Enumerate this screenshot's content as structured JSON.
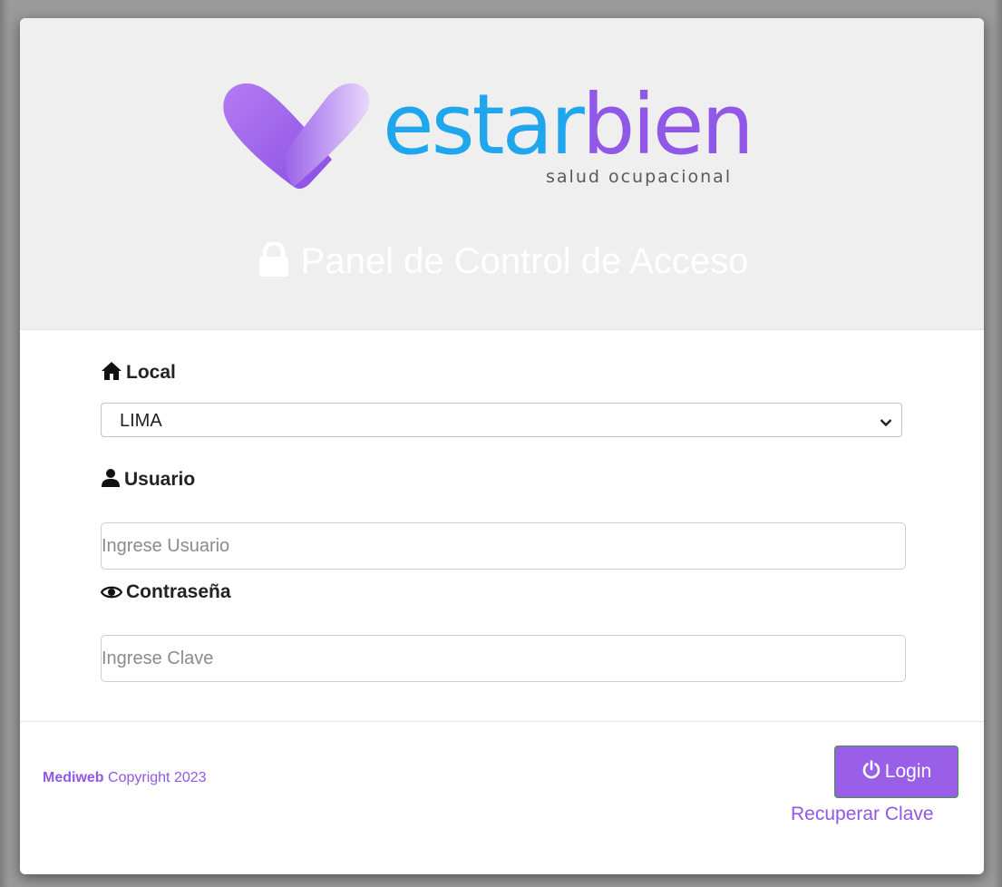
{
  "brand": {
    "wordmark_part1": "estar",
    "wordmark_part2": "bien",
    "tagline": "salud ocupacional",
    "color_blue": "#1fa6ec",
    "color_purple": "#9157e6"
  },
  "header": {
    "title": "Panel de Control de Acceso",
    "title_icon": "lock-icon"
  },
  "form": {
    "local": {
      "label": "Local",
      "icon": "home-icon",
      "selected": "LIMA"
    },
    "usuario": {
      "label": "Usuario",
      "icon": "user-icon",
      "placeholder": "Ingrese Usuario",
      "value": ""
    },
    "password": {
      "label": "Contraseña",
      "icon": "eye-icon",
      "placeholder": "Ingrese Clave",
      "value": ""
    }
  },
  "footer": {
    "brand": "Mediweb",
    "copyright": "Copyright 2023",
    "login_label": "Login",
    "login_icon": "power-icon",
    "recover_label": "Recuperar Clave",
    "accent": "#9a5fe8"
  }
}
